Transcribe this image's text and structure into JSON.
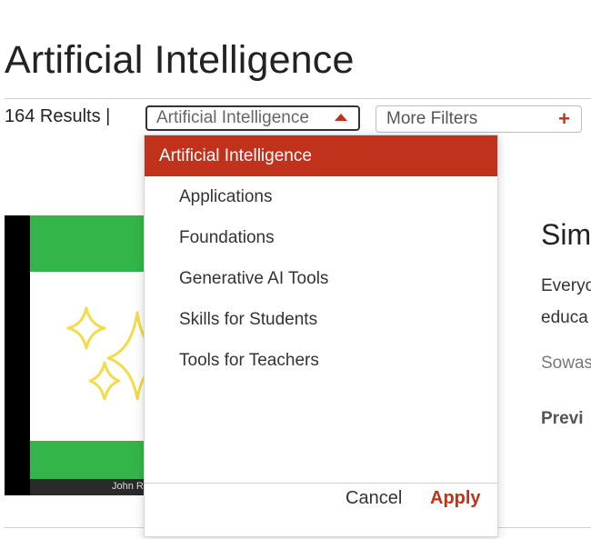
{
  "page": {
    "title": "Artificial Intelligence",
    "results": "164 Results |"
  },
  "filters": {
    "topic_selected": "Artificial Intelligence",
    "more_filters_label": "More Filters",
    "more_filters_icon": "+"
  },
  "dropdown": {
    "header": "Artificial Intelligence",
    "options": [
      "Applications",
      "Foundations",
      "Generative AI Tools",
      "Skills for Students",
      "Tools for Teachers"
    ],
    "cancel_label": "Cancel",
    "apply_label": "Apply"
  },
  "card": {
    "title": "Sim",
    "description_line1": "Everyo",
    "description_line2": "educa",
    "author": "Sowas",
    "preview_label": "Previ",
    "thumbnail_caption": "John R"
  },
  "colors": {
    "accent": "#c0321b",
    "thumbnail_green": "#34b54a",
    "sparkle_yellow": "#f2dc4a"
  },
  "icons": {
    "caret": "caret-up-icon",
    "plus": "plus-icon",
    "sparkles": "sparkles-icon"
  }
}
